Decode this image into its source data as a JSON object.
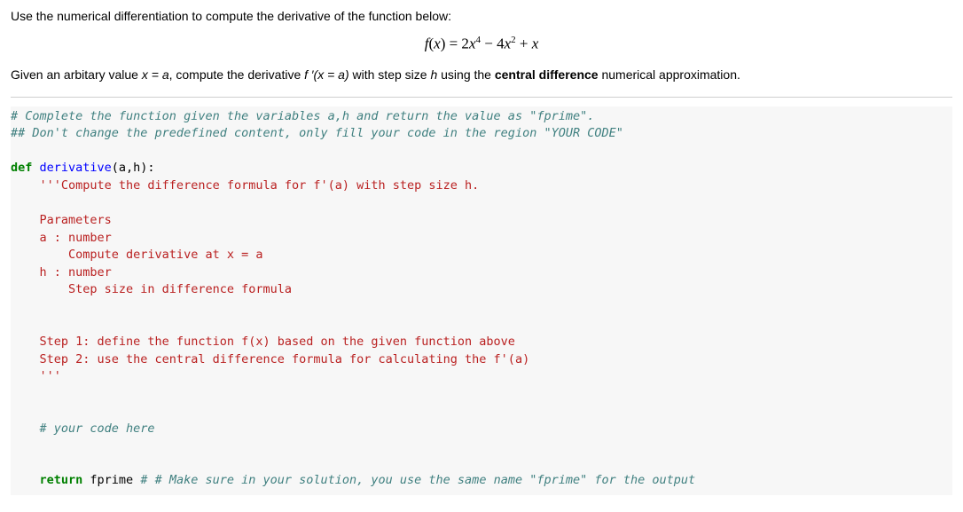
{
  "prose": {
    "line1": "Use the numerical differentiation to compute the derivative of the function below:",
    "line2_pre": "Given an arbitary value ",
    "line2_eq1": "x = a",
    "line2_mid": ", compute the derivative ",
    "line2_fprime": "f ′(x = a)",
    "line2_mid2": " with step size ",
    "line2_h": "h",
    "line2_mid3": " using the ",
    "line2_bold": "central difference",
    "line2_end": " numerical approximation."
  },
  "formula": {
    "lhs_f": "f",
    "lhs_paren": "(",
    "lhs_x": "x",
    "lhs_close": ") = 2",
    "x1": "x",
    "sup4": "4",
    "minus": " − 4",
    "x2": "x",
    "sup2": "2",
    "tail": " + ",
    "x3": "x"
  },
  "code": {
    "c1": "# Complete the function given the variables a,h and return the value as \"fprime\".",
    "c2": "## Don't change the predefined content, only fill your code in the region \"YOUR CODE\"",
    "def_kw": "def",
    "def_name": " derivative",
    "def_sig": "(a,h):",
    "doc1": "    '''Compute the difference formula for f'(a) with step size h.",
    "doc_blank": "",
    "doc2": "    Parameters",
    "doc3": "    a : number",
    "doc4": "        Compute derivative at x = a",
    "doc5": "    h : number",
    "doc6": "        Step size in difference formula",
    "doc7": "    Step 1: define the function f(x) based on the given function above",
    "doc8": "    Step 2: use the central difference formula for calculating the f'(a)",
    "doc9": "    '''",
    "yc": "    # your code here",
    "ret_kw": "    return",
    "ret_var": " fprime ",
    "ret_cm": "# # Make sure in your solution, you use the same name \"fprime\" for the output"
  }
}
